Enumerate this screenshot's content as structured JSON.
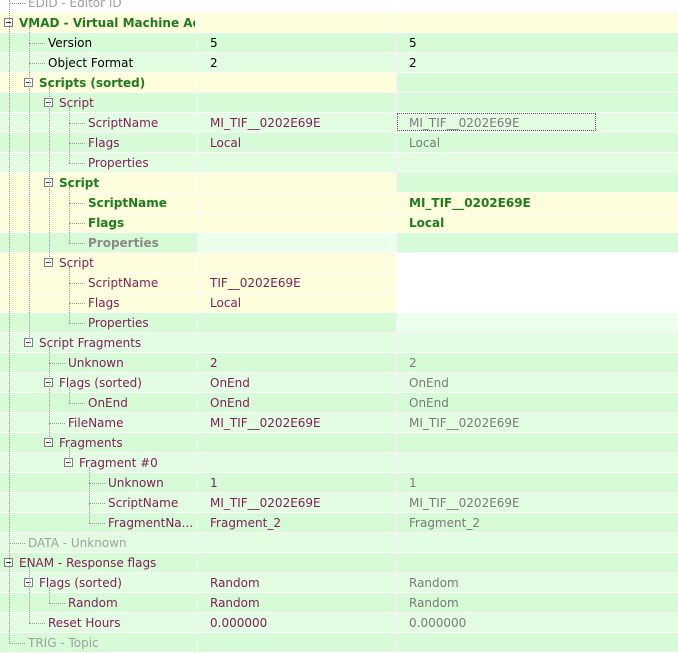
{
  "tree": {
    "rows": [
      {
        "name": "edid-row",
        "depth": 0,
        "label": "EDID - Editor ID",
        "style": "gray",
        "value1": "",
        "value2": "",
        "bg": [
          "#ffffff",
          "#ffffff",
          "#ffffff"
        ]
      },
      {
        "name": "vmad-row",
        "depth": 0,
        "expander": true,
        "label": "VMAD - Virtual Machine Ad...",
        "style": "green-b",
        "value1": "",
        "value2": "",
        "bg": [
          "#fefedc",
          "#fefedc",
          "#fefedc"
        ]
      },
      {
        "name": "version-row",
        "depth": 1,
        "label": "Version",
        "style": "dark",
        "value1": "5",
        "value2": "5",
        "v1style": "dark",
        "v2style": "dark",
        "bg": [
          "#d7fbd7",
          "#d7fbd7",
          "#d7fbd7"
        ]
      },
      {
        "name": "object-format-row",
        "depth": 1,
        "label": "Object Format",
        "style": "dark",
        "value1": "2",
        "value2": "2",
        "v1style": "dark",
        "v2style": "dark",
        "bg": [
          "#e3fde3",
          "#e3fde3",
          "#e3fde3"
        ]
      },
      {
        "name": "scripts-sorted-row",
        "depth": 1,
        "expander": true,
        "label": "Scripts (sorted)",
        "style": "green-b",
        "value1": "",
        "value2": "",
        "bg": [
          "#fefedc",
          "#fefedc",
          "#d7fbd7"
        ]
      },
      {
        "name": "script-1-row",
        "depth": 2,
        "expander": true,
        "label": "Script",
        "style": "purple",
        "value1": "",
        "value2": "",
        "bg": [
          "#d7fbd7",
          "#d7fbd7",
          "#d7fbd7"
        ]
      },
      {
        "name": "script-1-scriptname-row",
        "depth": 3,
        "label": "ScriptName",
        "style": "purple",
        "value1": "MI_TIF__0202E69E",
        "value2": "MI_TIF__0202E69E",
        "v1style": "purple",
        "v2style": "conflict",
        "selected": true,
        "bg": [
          "#e3fde3",
          "#e3fde3",
          "#e3fde3"
        ]
      },
      {
        "name": "script-1-flags-row",
        "depth": 3,
        "label": "Flags",
        "style": "purple",
        "value1": "Local",
        "value2": "Local",
        "v1style": "purple",
        "v2style": "conflict",
        "bg": [
          "#d7fbd7",
          "#d7fbd7",
          "#d7fbd7"
        ]
      },
      {
        "name": "script-1-properties-row",
        "depth": 3,
        "label": "Properties",
        "style": "purple",
        "value1": "",
        "value2": "",
        "bg": [
          "#e3fde3",
          "#e3fde3",
          "#e3fde3"
        ]
      },
      {
        "name": "script-2-row",
        "depth": 2,
        "expander": true,
        "label": "Script",
        "style": "green-b",
        "value1": "",
        "value2": "",
        "bg": [
          "#fefedc",
          "#fefedc",
          "#d7fbd7"
        ]
      },
      {
        "name": "script-2-scriptname-row",
        "depth": 3,
        "label": "ScriptName",
        "style": "green-b",
        "value1": "",
        "value2": "MI_TIF__0202E69E",
        "v1style": "dark",
        "v2style": "green-b",
        "bg": [
          "#fefedc",
          "#fefedc",
          "#fefedc"
        ]
      },
      {
        "name": "script-2-flags-row",
        "depth": 3,
        "label": "Flags",
        "style": "green-b",
        "value1": "",
        "value2": "Local",
        "v1style": "dark",
        "v2style": "green-b",
        "bg": [
          "#fefedc",
          "#fefedc",
          "#fefedc"
        ]
      },
      {
        "name": "script-2-properties-row",
        "depth": 3,
        "label": "Properties",
        "style": "gray-b",
        "value1": "",
        "value2": "",
        "bg": [
          "#d7fbd7",
          "#ecfeec",
          "#d7fbd7"
        ]
      },
      {
        "name": "script-3-row",
        "depth": 2,
        "expander": true,
        "label": "Script",
        "style": "purple",
        "value1": "",
        "value2": "",
        "bg": [
          "#fefedc",
          "#fefedc",
          "#ffffff"
        ]
      },
      {
        "name": "script-3-scriptname-row",
        "depth": 3,
        "label": "ScriptName",
        "style": "purple",
        "value1": "TIF__0202E69E",
        "value2": "",
        "v1style": "purple",
        "v2style": "dark",
        "bg": [
          "#fefedc",
          "#fefedc",
          "#ffffff"
        ]
      },
      {
        "name": "script-3-flags-row",
        "depth": 3,
        "label": "Flags",
        "style": "purple",
        "value1": "Local",
        "value2": "",
        "v1style": "purple",
        "v2style": "dark",
        "bg": [
          "#fefedc",
          "#fefedc",
          "#ffffff"
        ]
      },
      {
        "name": "script-3-properties-row",
        "depth": 3,
        "label": "Properties",
        "style": "purple",
        "value1": "",
        "value2": "",
        "bg": [
          "#d7fbd7",
          "#d7fbd7",
          "#ecfeec"
        ]
      },
      {
        "name": "script-fragments-row",
        "depth": 1,
        "expander": true,
        "label": "Script Fragments",
        "style": "purple",
        "value1": "",
        "value2": "",
        "bg": [
          "#e3fde3",
          "#e3fde3",
          "#e3fde3"
        ]
      },
      {
        "name": "fragments-unknown-row",
        "depth": 2,
        "label": "Unknown",
        "style": "purple",
        "value1": "2",
        "value2": "2",
        "v1style": "purple",
        "v2style": "conflict",
        "bg": [
          "#d7fbd7",
          "#d7fbd7",
          "#d7fbd7"
        ]
      },
      {
        "name": "flags-sorted-row",
        "depth": 2,
        "expander": true,
        "label": "Flags (sorted)",
        "style": "purple",
        "value1": "OnEnd",
        "value2": "OnEnd",
        "v1style": "purple",
        "v2style": "conflict",
        "bg": [
          "#e3fde3",
          "#e3fde3",
          "#e3fde3"
        ]
      },
      {
        "name": "onend-row",
        "depth": 3,
        "label": "OnEnd",
        "style": "purple",
        "value1": "OnEnd",
        "value2": "OnEnd",
        "v1style": "purple",
        "v2style": "conflict",
        "bg": [
          "#d7fbd7",
          "#d7fbd7",
          "#d7fbd7"
        ]
      },
      {
        "name": "filename-row",
        "depth": 2,
        "label": "FileName",
        "style": "purple",
        "value1": "MI_TIF__0202E69E",
        "value2": "MI_TIF__0202E69E",
        "v1style": "purple",
        "v2style": "conflict",
        "bg": [
          "#e3fde3",
          "#e3fde3",
          "#e3fde3"
        ]
      },
      {
        "name": "fragments-row",
        "depth": 2,
        "expander": true,
        "label": "Fragments",
        "style": "purple",
        "value1": "",
        "value2": "",
        "bg": [
          "#d7fbd7",
          "#d7fbd7",
          "#d7fbd7"
        ]
      },
      {
        "name": "fragment-0-row",
        "depth": 3,
        "expander": true,
        "label": "Fragment #0",
        "style": "purple",
        "value1": "",
        "value2": "",
        "bg": [
          "#e3fde3",
          "#e3fde3",
          "#e3fde3"
        ]
      },
      {
        "name": "fragment-0-unknown-row",
        "depth": 4,
        "label": "Unknown",
        "style": "purple",
        "value1": "1",
        "value2": "1",
        "v1style": "purple",
        "v2style": "conflict",
        "bg": [
          "#d7fbd7",
          "#d7fbd7",
          "#d7fbd7"
        ]
      },
      {
        "name": "fragment-0-scriptname-row",
        "depth": 4,
        "label": "ScriptName",
        "style": "purple",
        "value1": "MI_TIF__0202E69E",
        "value2": "MI_TIF__0202E69E",
        "v1style": "purple",
        "v2style": "conflict",
        "bg": [
          "#e3fde3",
          "#e3fde3",
          "#e3fde3"
        ]
      },
      {
        "name": "fragment-0-fragmentname-row",
        "depth": 4,
        "label": "FragmentNa...",
        "style": "purple",
        "value1": "Fragment_2",
        "value2": "Fragment_2",
        "v1style": "purple",
        "v2style": "conflict",
        "bg": [
          "#d7fbd7",
          "#d7fbd7",
          "#d7fbd7"
        ]
      },
      {
        "name": "data-row",
        "depth": 0,
        "label": "DATA - Unknown",
        "style": "gray",
        "value1": "",
        "value2": "",
        "bg": [
          "#e3fde3",
          "#e3fde3",
          "#e3fde3"
        ]
      },
      {
        "name": "enam-row",
        "depth": 0,
        "expander": true,
        "label": "ENAM - Response flags",
        "style": "purple",
        "value1": "",
        "value2": "",
        "bg": [
          "#d7fbd7",
          "#d7fbd7",
          "#d7fbd7"
        ]
      },
      {
        "name": "enam-flags-sorted-row",
        "depth": 1,
        "expander": true,
        "label": "Flags (sorted)",
        "style": "purple",
        "value1": "Random",
        "value2": "Random",
        "v1style": "purple",
        "v2style": "conflict",
        "bg": [
          "#e3fde3",
          "#e3fde3",
          "#e3fde3"
        ]
      },
      {
        "name": "random-row",
        "depth": 2,
        "label": "Random",
        "style": "purple",
        "value1": "Random",
        "value2": "Random",
        "v1style": "purple",
        "v2style": "conflict",
        "bg": [
          "#d7fbd7",
          "#d7fbd7",
          "#d7fbd7"
        ]
      },
      {
        "name": "reset-hours-row",
        "depth": 1,
        "label": "Reset Hours",
        "style": "purple",
        "value1": "0.000000",
        "value2": "0.000000",
        "v1style": "purple",
        "v2style": "conflict",
        "bg": [
          "#e3fde3",
          "#e3fde3",
          "#e3fde3"
        ]
      },
      {
        "name": "trig-row",
        "depth": 0,
        "label": "TRIG - Topic",
        "style": "gray",
        "value1": "",
        "value2": "",
        "bg": [
          "#d7fbd7",
          "#d7fbd7",
          "#d7fbd7"
        ]
      }
    ]
  }
}
